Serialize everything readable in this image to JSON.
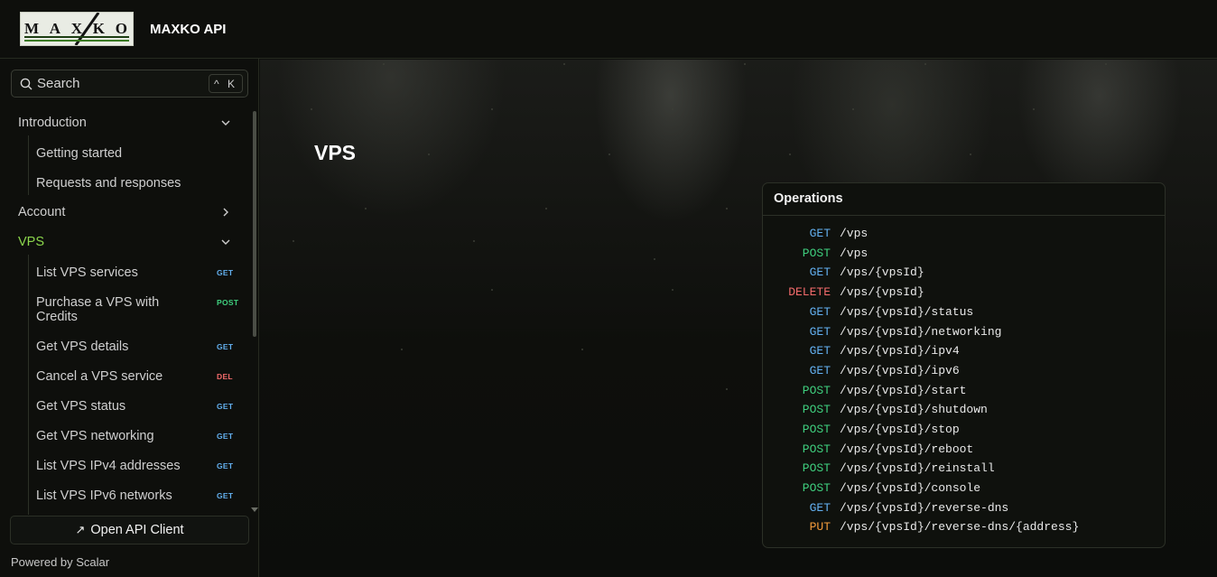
{
  "app": {
    "logo_text": "MAXKO",
    "brand": "MAXKO API"
  },
  "search": {
    "label": "Search",
    "shortcut": "^ K"
  },
  "sidebar": {
    "sections": [
      {
        "label": "Introduction",
        "expanded": true
      },
      {
        "label": "Account",
        "expanded": false
      },
      {
        "label": "VPS",
        "expanded": true,
        "active": true
      }
    ],
    "intro_items": [
      "Getting started",
      "Requests and responses"
    ],
    "vps_items": [
      {
        "label": "List VPS services",
        "method": "GET"
      },
      {
        "label": "Purchase a VPS with Credits",
        "method": "POST"
      },
      {
        "label": "Get VPS details",
        "method": "GET"
      },
      {
        "label": "Cancel a VPS service",
        "method": "DEL"
      },
      {
        "label": "Get VPS status",
        "method": "GET"
      },
      {
        "label": "Get VPS networking",
        "method": "GET"
      },
      {
        "label": "List VPS IPv4 addresses",
        "method": "GET"
      },
      {
        "label": "List VPS IPv6 networks",
        "method": "GET"
      }
    ],
    "open_client": "Open API Client",
    "powered_by": "Powered by Scalar"
  },
  "main": {
    "title": "VPS",
    "operations_title": "Operations",
    "operations": [
      {
        "method": "GET",
        "path": "/vps"
      },
      {
        "method": "POST",
        "path": "/vps"
      },
      {
        "method": "GET",
        "path": "/vps/{vpsId}"
      },
      {
        "method": "DELETE",
        "path": "/vps/{vpsId}"
      },
      {
        "method": "GET",
        "path": "/vps/{vpsId}/status"
      },
      {
        "method": "GET",
        "path": "/vps/{vpsId}/networking"
      },
      {
        "method": "GET",
        "path": "/vps/{vpsId}/ipv4"
      },
      {
        "method": "GET",
        "path": "/vps/{vpsId}/ipv6"
      },
      {
        "method": "POST",
        "path": "/vps/{vpsId}/start"
      },
      {
        "method": "POST",
        "path": "/vps/{vpsId}/shutdown"
      },
      {
        "method": "POST",
        "path": "/vps/{vpsId}/stop"
      },
      {
        "method": "POST",
        "path": "/vps/{vpsId}/reboot"
      },
      {
        "method": "POST",
        "path": "/vps/{vpsId}/reinstall"
      },
      {
        "method": "POST",
        "path": "/vps/{vpsId}/console"
      },
      {
        "method": "GET",
        "path": "/vps/{vpsId}/reverse-dns"
      },
      {
        "method": "PUT",
        "path": "/vps/{vpsId}/reverse-dns/{address}"
      }
    ]
  },
  "colors": {
    "accent": "#8bd64c",
    "get": "#63b0f0",
    "post": "#3fcf7e",
    "delete": "#f26b6b",
    "put": "#f29a3a",
    "background": "#0e0f0c"
  }
}
